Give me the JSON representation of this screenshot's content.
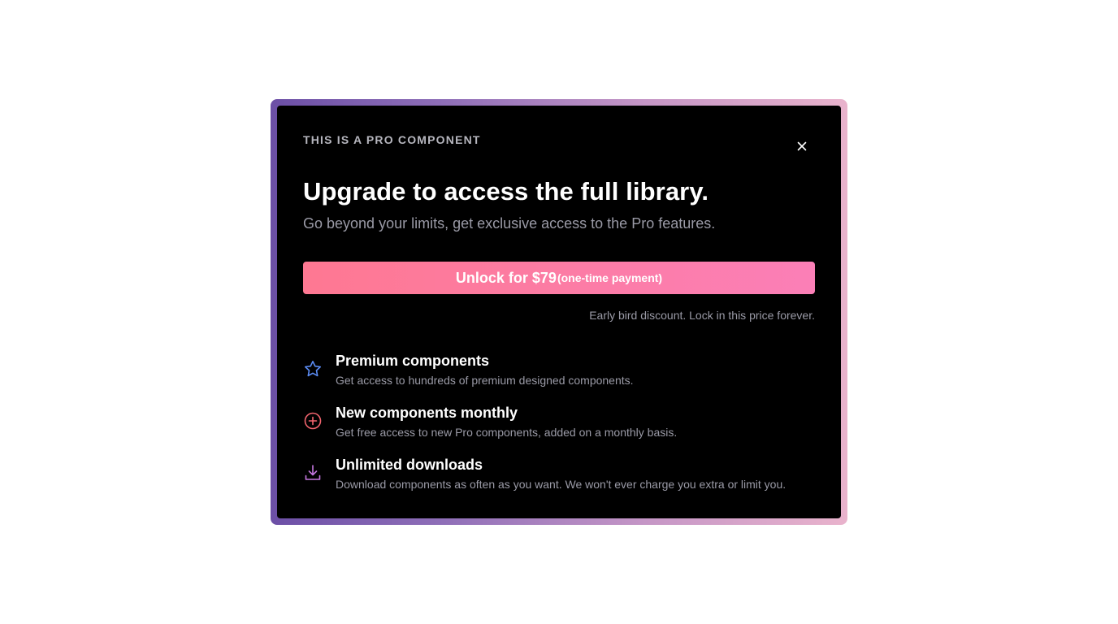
{
  "modal": {
    "eyebrow": "This is a Pro component",
    "title": "Upgrade to access the full library.",
    "subtitle": "Go beyond your limits, get exclusive access to the Pro features.",
    "close_icon": "close-icon",
    "cta": {
      "main_label": "Unlock for $79",
      "sub_label": "(one-time payment)"
    },
    "note": "Early bird discount. Lock in this price forever.",
    "features": [
      {
        "icon": "star-icon",
        "icon_color": "#5b8cf5",
        "title": "Premium components",
        "description": "Get access to hundreds of premium designed components."
      },
      {
        "icon": "plus-circle-icon",
        "icon_color": "#f2646e",
        "title": "New components monthly",
        "description": "Get free access to new Pro components, added on a monthly basis."
      },
      {
        "icon": "download-icon",
        "icon_color": "#c577e0",
        "title": "Unlimited downloads",
        "description": "Download components as often as you want. We won't ever charge you extra or limit you."
      }
    ]
  },
  "colors": {
    "frame_gradient_start": "#6c4fa6",
    "frame_gradient_end": "#e9b3cc",
    "cta_gradient_start": "#fe7892",
    "cta_gradient_end": "#fb7fb7",
    "modal_background": "#000000",
    "muted_text": "#9a9aa6"
  }
}
